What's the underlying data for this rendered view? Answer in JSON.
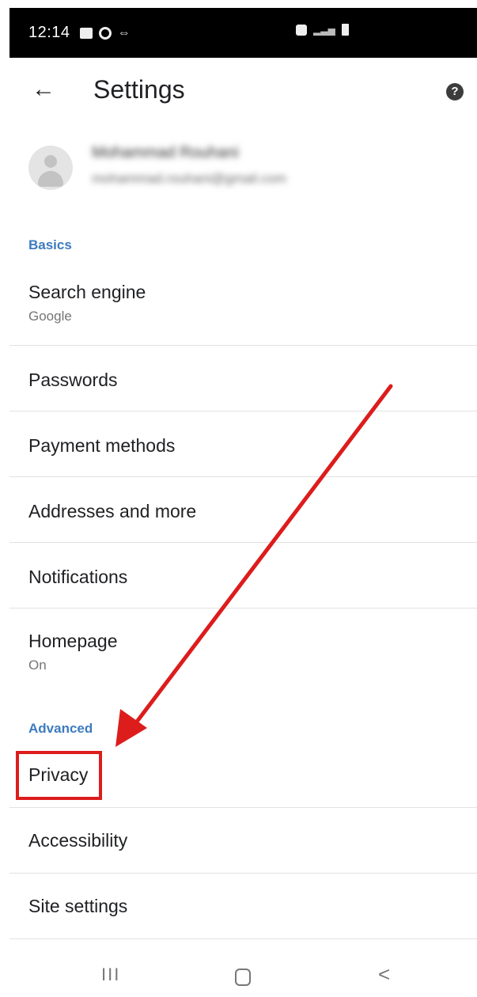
{
  "status_bar": {
    "time": "12:14"
  },
  "app_bar": {
    "back_icon": "arrow-left-icon",
    "title": "Settings",
    "help_icon": "help-circle-icon",
    "help_glyph": "?"
  },
  "account": {
    "name": "Mohammad Rouhani",
    "email": "mohammad.rouhani@gmail.com"
  },
  "sections": {
    "basics": "Basics",
    "advanced": "Advanced"
  },
  "items": {
    "search_engine": {
      "title": "Search engine",
      "subtitle": "Google"
    },
    "passwords": {
      "title": "Passwords"
    },
    "payment_methods": {
      "title": "Payment methods"
    },
    "addresses": {
      "title": "Addresses and more"
    },
    "notifications": {
      "title": "Notifications"
    },
    "homepage": {
      "title": "Homepage",
      "subtitle": "On"
    },
    "privacy": {
      "title": "Privacy"
    },
    "accessibility": {
      "title": "Accessibility"
    },
    "site_settings": {
      "title": "Site settings"
    }
  },
  "annotation": {
    "color": "#dd1c1c"
  },
  "nav_bar": {
    "recents_glyph": "III",
    "back_glyph": "<"
  },
  "colors": {
    "accent": "#3c7bbf",
    "text_primary": "#202124",
    "text_secondary": "#757575"
  }
}
